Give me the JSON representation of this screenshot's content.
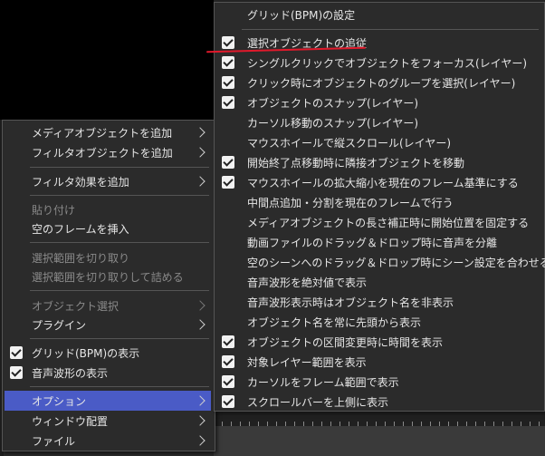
{
  "context_menu": {
    "items": [
      {
        "label": "メディアオブジェクトを追加",
        "submenu": true
      },
      {
        "label": "フィルタオブジェクトを追加",
        "submenu": true
      },
      {
        "label": "フィルタ効果を追加",
        "submenu": true
      },
      {
        "label": "貼り付け",
        "disabled": true
      },
      {
        "label": "空のフレームを挿入"
      },
      {
        "label": "選択範囲を切り取り",
        "disabled": true
      },
      {
        "label": "選択範囲を切り取りして詰める",
        "disabled": true
      },
      {
        "label": "オブジェクト選択",
        "disabled": true,
        "submenu": true
      },
      {
        "label": "プラグイン",
        "submenu": true
      },
      {
        "label": "グリッド(BPM)の表示",
        "checked": true
      },
      {
        "label": "音声波形の表示",
        "checked": true
      },
      {
        "label": "オプション",
        "submenu": true,
        "highlighted": true
      },
      {
        "label": "ウィンドウ配置",
        "submenu": true
      },
      {
        "label": "ファイル",
        "submenu": true
      }
    ]
  },
  "options_submenu": {
    "items": [
      {
        "label": "グリッド(BPM)の設定",
        "checked": false
      },
      {
        "label": "選択オブジェクトの追従",
        "checked": true
      },
      {
        "label": "シングルクリックでオブジェクトをフォーカス(レイヤー)",
        "checked": false
      },
      {
        "label": "クリック時にオブジェクトのグループを選択(レイヤー)",
        "checked": true
      },
      {
        "label": "オブジェクトのスナップ(レイヤー)",
        "checked": true
      },
      {
        "label": "カーソル移動のスナップ(レイヤー)",
        "checked": false
      },
      {
        "label": "マウスホイールで縦スクロール(レイヤー)",
        "checked": false
      },
      {
        "label": "開始終了点移動時に隣接オブジェクトを移動",
        "checked": true
      },
      {
        "label": "マウスホイールの拡大縮小を現在のフレーム基準にする",
        "checked": true
      },
      {
        "label": "中間点追加・分割を現在のフレームで行う",
        "checked": false
      },
      {
        "label": "メディアオブジェクトの長さ補正時に開始位置を固定する",
        "checked": false
      },
      {
        "label": "動画ファイルのドラッグ＆ドロップ時に音声を分離",
        "checked": false
      },
      {
        "label": "空のシーンへのドラッグ＆ドロップ時にシーン設定を合わせる",
        "checked": false
      },
      {
        "label": "音声波形を絶対値で表示",
        "checked": false
      },
      {
        "label": "音声波形表示時はオブジェクト名を非表示",
        "checked": false
      },
      {
        "label": "オブジェクト名を常に先頭から表示",
        "checked": false
      },
      {
        "label": "オブジェクトの区間変更時に時間を表示",
        "checked": true
      },
      {
        "label": "対象レイヤー範囲を表示",
        "checked": true
      },
      {
        "label": "カーソルをフレーム範囲で表示",
        "checked": true
      },
      {
        "label": "スクロールバーを上側に表示",
        "checked": true
      }
    ]
  },
  "annotation": {
    "color": "#e0192b"
  },
  "colors": {
    "highlight": "#4a5bc6",
    "menu_bg": "#2b2b2b"
  }
}
